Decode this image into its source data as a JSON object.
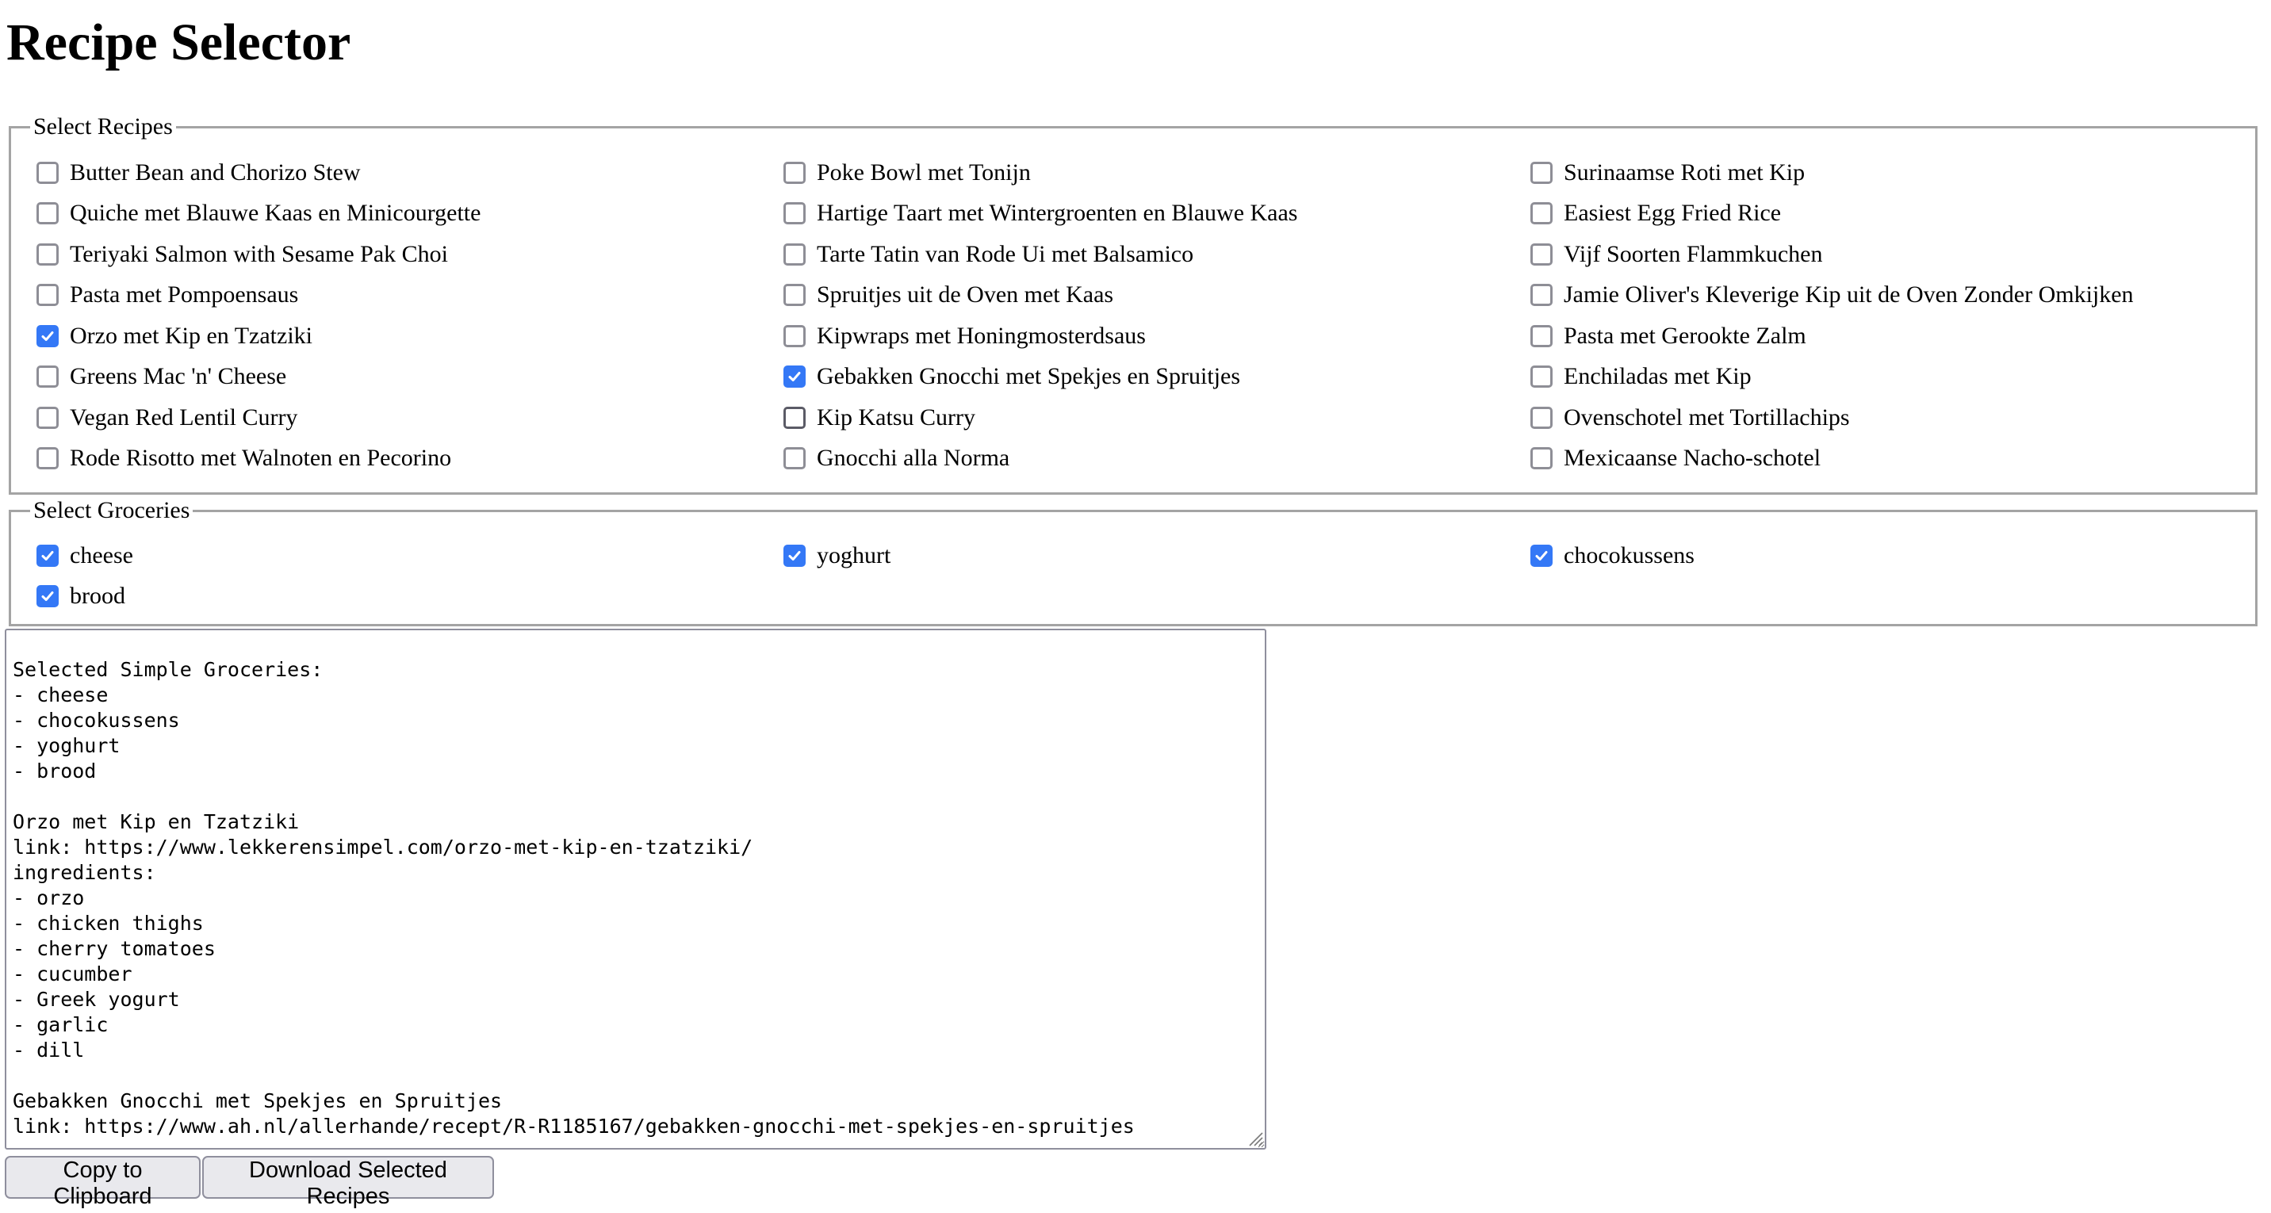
{
  "page": {
    "title": "Recipe Selector"
  },
  "recipes": {
    "legend": "Select Recipes",
    "items": [
      {
        "label": "Butter Bean and Chorizo Stew",
        "checked": false
      },
      {
        "label": "Poke Bowl met Tonijn",
        "checked": false
      },
      {
        "label": "Surinaamse Roti met Kip",
        "checked": false
      },
      {
        "label": "Quiche met Blauwe Kaas en Minicourgette",
        "checked": false
      },
      {
        "label": "Hartige Taart met Wintergroenten en Blauwe Kaas",
        "checked": false
      },
      {
        "label": "Easiest Egg Fried Rice",
        "checked": false
      },
      {
        "label": "Teriyaki Salmon with Sesame Pak Choi",
        "checked": false
      },
      {
        "label": "Tarte Tatin van Rode Ui met Balsamico",
        "checked": false
      },
      {
        "label": "Vijf Soorten Flammkuchen",
        "checked": false
      },
      {
        "label": "Pasta met Pompoensaus",
        "checked": false
      },
      {
        "label": "Spruitjes uit de Oven met Kaas",
        "checked": false
      },
      {
        "label": "Jamie Oliver's Kleverige Kip uit de Oven Zonder Omkijken",
        "checked": false
      },
      {
        "label": "Orzo met Kip en Tzatziki",
        "checked": true
      },
      {
        "label": "Kipwraps met Honingmosterdsaus",
        "checked": false
      },
      {
        "label": "Pasta met Gerookte Zalm",
        "checked": false
      },
      {
        "label": "Greens Mac 'n' Cheese",
        "checked": false
      },
      {
        "label": "Gebakken Gnocchi met Spekjes en Spruitjes",
        "checked": true
      },
      {
        "label": "Enchiladas met Kip",
        "checked": false
      },
      {
        "label": "Vegan Red Lentil Curry",
        "checked": false
      },
      {
        "label": "Kip Katsu Curry",
        "checked": false,
        "hovered": true
      },
      {
        "label": "Ovenschotel met Tortillachips",
        "checked": false
      },
      {
        "label": "Rode Risotto met Walnoten en Pecorino",
        "checked": false
      },
      {
        "label": "Gnocchi alla Norma",
        "checked": false
      },
      {
        "label": "Mexicaanse Nacho-schotel",
        "checked": false
      }
    ]
  },
  "groceries": {
    "legend": "Select Groceries",
    "items": [
      {
        "label": "cheese",
        "checked": true
      },
      {
        "label": "yoghurt",
        "checked": true
      },
      {
        "label": "chocokussens",
        "checked": true
      },
      {
        "label": "brood",
        "checked": true
      }
    ]
  },
  "output": {
    "text": "\nSelected Simple Groceries:\n- cheese\n- chocokussens\n- yoghurt\n- brood\n\nOrzo met Kip en Tzatziki\nlink: https://www.lekkerensimpel.com/orzo-met-kip-en-tzatziki/\ningredients:\n- orzo\n- chicken thighs\n- cherry tomatoes\n- cucumber\n- Greek yogurt\n- garlic\n- dill\n\nGebakken Gnocchi met Spekjes en Spruitjes\nlink: https://www.ah.nl/allerhande/recept/R-R1185167/gebakken-gnocchi-met-spekjes-en-spruitjes"
  },
  "buttons": {
    "copy": "Copy to Clipboard",
    "download": "Download Selected Recipes"
  },
  "colors": {
    "checkbox_checked": "#3478f6",
    "checkbox_border": "#8e8e96",
    "fieldset_border": "#a4a4a4",
    "button_bg": "#e9e9ed"
  }
}
